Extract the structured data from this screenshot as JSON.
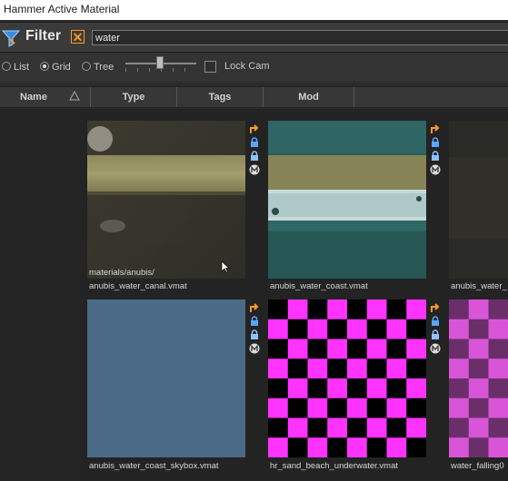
{
  "window": {
    "title": "Hammer Active Material"
  },
  "filter": {
    "label": "Filter",
    "clear_glyph": "✕",
    "search_value": "water",
    "accent_color": "#ff9a22",
    "filter_icon_color": "#3a8de0"
  },
  "view": {
    "options": [
      "List",
      "Grid",
      "Tree"
    ],
    "selected": "Grid",
    "thumbnail_size_slider": 0.47,
    "lock_cam_label": "Lock Cam",
    "lock_cam_checked": false
  },
  "columns": [
    "Name",
    "Type",
    "Tags",
    "Mod"
  ],
  "assets": [
    {
      "path": "materials/anubis/",
      "name": "anubis_water_canal.vmat",
      "preview": "canal"
    },
    {
      "path": "",
      "name": "anubis_water_coast.vmat",
      "preview": "coast"
    },
    {
      "path": "",
      "name": "anubis_water_",
      "preview": "dark"
    },
    {
      "path": "",
      "name": "anubis_water_coast_skybox.vmat",
      "preview": "skybox"
    },
    {
      "path": "",
      "name": "hr_sand_beach_underwater.vmat",
      "preview": "checker"
    },
    {
      "path": "",
      "name": "water_falling0",
      "preview": "checker-dim"
    }
  ],
  "item_icons": [
    "goto-arrow-icon",
    "lock-icon",
    "lock-icon",
    "model-m-icon"
  ]
}
